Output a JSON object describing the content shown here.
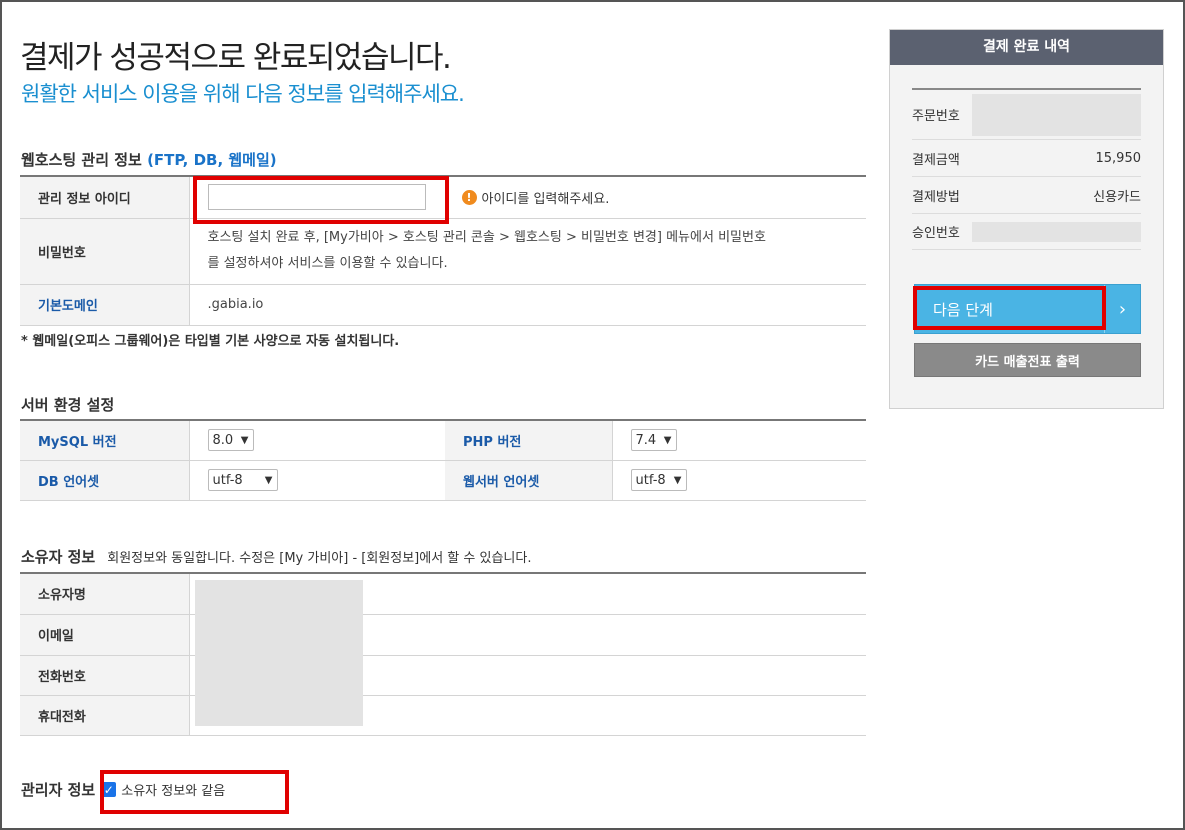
{
  "header": {
    "title": "결제가 성공적으로 완료되었습니다.",
    "subtitle": "원활한 서비스 이용을 위해 다음 정보를 입력해주세요."
  },
  "hosting": {
    "title_main": "웹호스팅 관리 정보 ",
    "title_blue": "(FTP, DB, 웹메일)",
    "id_label": "관리 정보 아이디",
    "id_value": "",
    "id_hint": "아이디를 입력해주세요.",
    "pw_label": "비밀번호",
    "pw_desc_1": "호스팅 설치 완료 후, [My가비아 > 호스팅 관리 콘솔 > 웹호스팅 > 비밀번호 변경] 메뉴에서 비밀번호",
    "pw_desc_2": "를 설정하셔야 서비스를 이용할 수 있습니다.",
    "domain_label": "기본도메인",
    "domain_value": ".gabia.io",
    "note": "* 웹메일(오피스 그룹웨어)은 타입별 기본 사양으로 자동 설치됩니다."
  },
  "server": {
    "title": "서버 환경 설정",
    "mysql_label": "MySQL 버전",
    "mysql_value": "8.0",
    "php_label": "PHP 버전",
    "php_value": "7.4",
    "db_charset_label": "DB 언어셋",
    "db_charset_value": "utf-8",
    "web_charset_label": "웹서버 언어셋",
    "web_charset_value": "utf-8"
  },
  "owner": {
    "title": "소유자 정보",
    "desc": "회원정보와 동일합니다. 수정은 [My 가비아] - [회원정보]에서 할 수 있습니다.",
    "rows": [
      "소유자명",
      "이메일",
      "전화번호",
      "휴대전화"
    ]
  },
  "admin": {
    "title": "관리자 정보",
    "same_as_owner": "소유자 정보와 같음",
    "checked": true
  },
  "summary": {
    "title": "결제 완료 내역",
    "order_no_label": "주문번호",
    "amount_label": "결제금액",
    "amount_value": "15,950",
    "method_label": "결제방법",
    "method_value": "신용카드",
    "approval_label": "승인번호",
    "next_button": "다음 단계",
    "receipt_button": "카드 매출전표 출력"
  },
  "colors": {
    "accent_blue": "#1a8fd0",
    "highlight_red": "#e00000",
    "panel_header": "#5b6170",
    "next_button": "#4ab4e4"
  }
}
